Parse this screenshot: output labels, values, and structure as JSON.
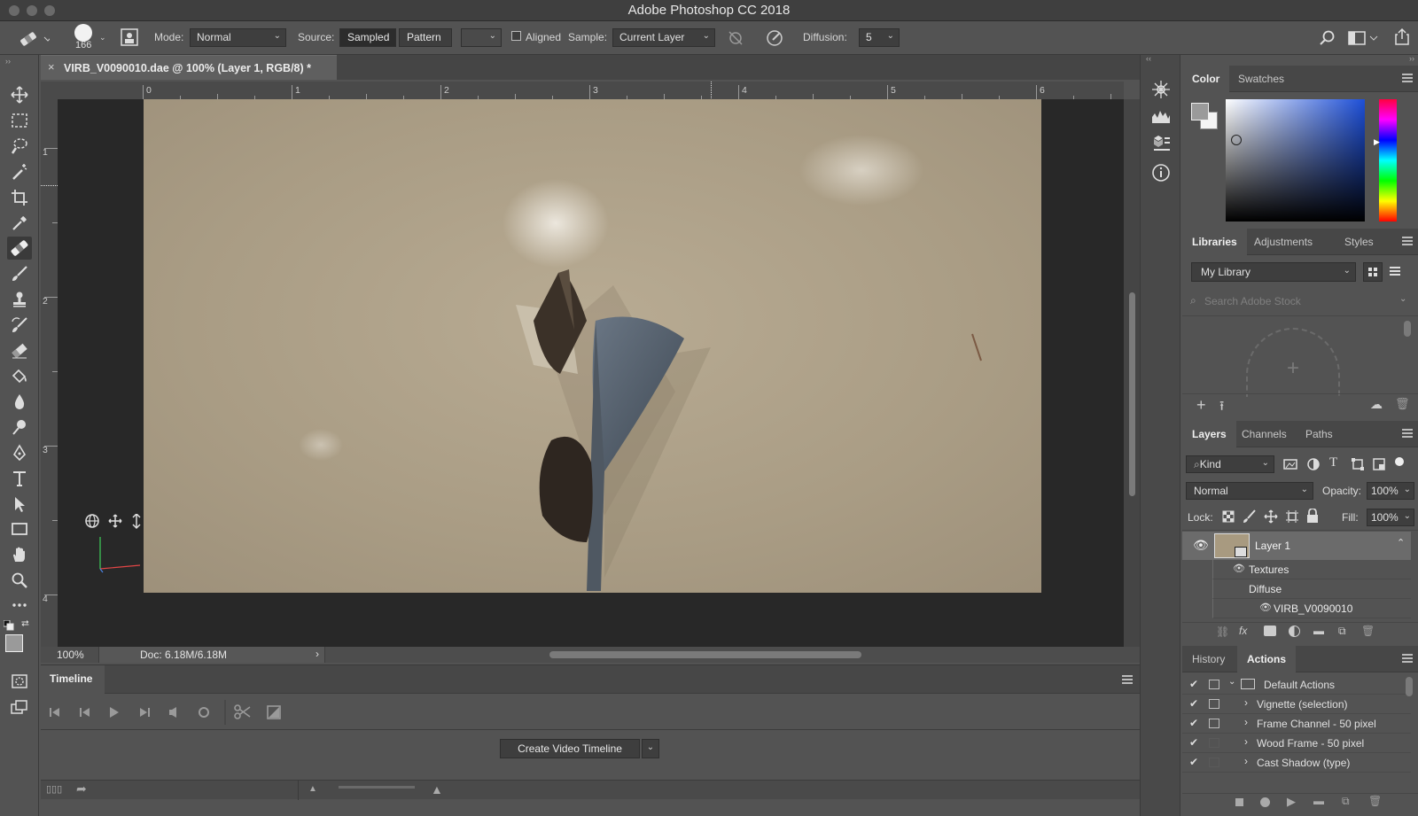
{
  "app": {
    "title": "Adobe Photoshop CC 2018"
  },
  "options": {
    "brush_size": "166",
    "mode_label": "Mode:",
    "mode_value": "Normal",
    "source_label": "Source:",
    "source_sampled": "Sampled",
    "source_pattern": "Pattern",
    "aligned_label": "Aligned",
    "sample_label": "Sample:",
    "sample_value": "Current Layer",
    "diffusion_label": "Diffusion:",
    "diffusion_value": "5"
  },
  "document": {
    "tab_title": "VIRB_V0090010.dae @ 100% (Layer 1, RGB/8) *",
    "zoom": "100%",
    "doc_size": "Doc: 6.18M/6.18M",
    "ruler_h": [
      "0",
      "1",
      "2",
      "3",
      "4",
      "5",
      "6"
    ],
    "ruler_v": [
      "1",
      "2",
      "3",
      "4"
    ]
  },
  "timeline": {
    "tab": "Timeline",
    "create_button": "Create Video Timeline"
  },
  "color_panel": {
    "tabs": [
      "Color",
      "Swatches"
    ],
    "active": "Color"
  },
  "libraries_panel": {
    "tabs": [
      "Libraries",
      "Adjustments",
      "Styles"
    ],
    "library_select": "My Library",
    "search_placeholder": "Search Adobe Stock"
  },
  "layers_panel": {
    "tabs": [
      "Layers",
      "Channels",
      "Paths"
    ],
    "filter_kind": "Kind",
    "blend_mode": "Normal",
    "opacity_label": "Opacity:",
    "opacity_value": "100%",
    "lock_label": "Lock:",
    "fill_label": "Fill:",
    "fill_value": "100%",
    "layer_name": "Layer 1",
    "sub_textures": "Textures",
    "sub_diffuse": "Diffuse",
    "sub_file": "VIRB_V0090010"
  },
  "actions_panel": {
    "tabs": [
      "History",
      "Actions"
    ],
    "items": [
      "Default Actions",
      "Vignette (selection)",
      "Frame Channel - 50 pixel",
      "Wood Frame - 50 pixel",
      "Cast Shadow (type)"
    ]
  },
  "colors": {
    "accent": "#2d8ceb",
    "panel_bg": "#535353",
    "canvas_bg": "#282828"
  }
}
